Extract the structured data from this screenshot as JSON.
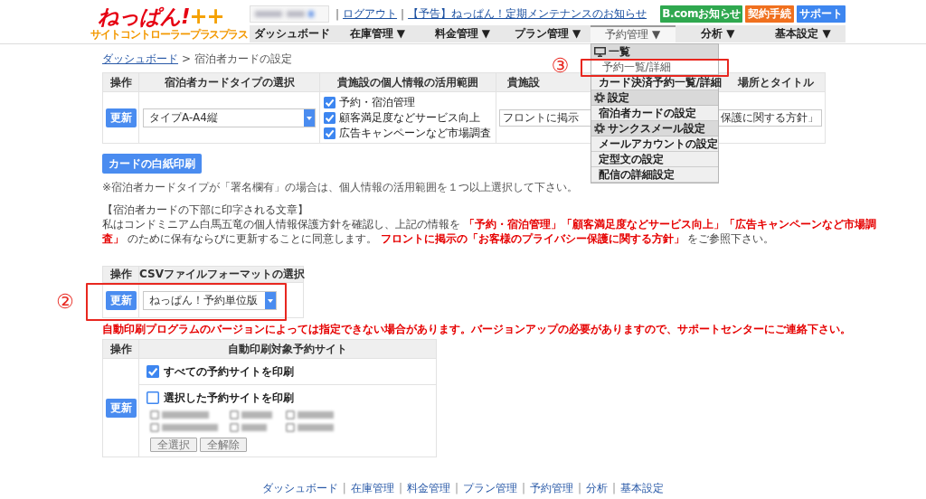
{
  "header": {
    "logo": {
      "name": "ねっぱん!",
      "plus": "++",
      "tagline": "サイトコントローラー",
      "tagline_small": "プラスプラス"
    },
    "separator": "|",
    "links": [
      "ログアウト",
      "【予告】ねっぱん！定期メンテナンスのお知らせ"
    ],
    "buttons": [
      {
        "label": "B.comお知らせ",
        "kind": "notice",
        "color": "#2fa84f"
      },
      {
        "label": "契約手続",
        "kind": "action",
        "color": "#f0701e"
      },
      {
        "label": "サポート",
        "kind": "action",
        "color": "#3d86f0"
      }
    ]
  },
  "nav": [
    {
      "label": "ダッシュボード",
      "selected": false
    },
    {
      "label": "在庫管理 ▼",
      "selected": false
    },
    {
      "label": "料金管理 ▼",
      "selected": false
    },
    {
      "label": "プラン管理 ▼",
      "selected": false
    },
    {
      "label": "予約管理 ▼",
      "selected": true
    },
    {
      "label": "分析 ▼",
      "selected": false
    },
    {
      "label": "基本設定 ▼",
      "selected": false
    }
  ],
  "menu": {
    "sections": [
      {
        "title": "一覧",
        "items": [
          {
            "label": "予約一覧/詳細",
            "selected": true
          },
          {
            "label": "カード決済予約一覧/詳細",
            "selected": false
          }
        ]
      },
      {
        "title": "設定",
        "items": [
          {
            "label": "宿泊者カードの設定",
            "selected": false
          }
        ]
      },
      {
        "title": "サンクスメール設定",
        "items": [
          {
            "label": "メールアカウントの設定",
            "selected": false
          },
          {
            "label": "定型文の設定",
            "selected": false
          },
          {
            "label": "配信の詳細設定",
            "selected": false
          }
        ]
      }
    ],
    "annotation": "③"
  },
  "breadcrumb": {
    "link": "ダッシュボード",
    "separator": ">",
    "current": "宿泊者カードの設定"
  },
  "card_table": {
    "columns": [
      "操作",
      "宿泊者カードタイプの選択",
      "貴施設の個人情報の活用範囲"
    ],
    "column_4": {
      "start": "貴施設",
      "end": "場所とタイトル"
    },
    "button": "更新",
    "card_type": "タイプA-A4縦",
    "scope": [
      {
        "label": "予約・宿泊管理",
        "checked": true
      },
      {
        "label": "顧客満足度などサービス向上",
        "checked": true
      },
      {
        "label": "広告キャンペーンなど市場調査",
        "checked": true
      }
    ],
    "column_4_field": {
      "start": "フロントに掲示",
      "end": "保護に関する方針」"
    }
  },
  "blank_print_button": "カードの白紙印刷",
  "note": "※宿泊者カードタイプが「署名欄有」の場合は、個人情報の活用範囲を１つ以上選択して下さい。",
  "printed_text": {
    "title": "【宿泊者カードの下部に印字される文章】",
    "body": "私はコンドミニアム白馬五竜の個人情報保護方針を確認し、上記の情報を **「予約・宿泊管理」「顧客満足度などサービス向上」「広告キャンペーンなど市場調査」** のために保有ならびに更新することに同意します。 **フロントに掲示の「お客様のプライバシー保護に関する方針」** をご参照下さい。"
  },
  "csv_table": {
    "columns": [
      "操作",
      "CSVファイルフォーマットの選択"
    ],
    "button": "更新",
    "format": "ねっぱん！予約単位版",
    "annotation": "②"
  },
  "warning": "自動印刷プログラムのバージョンによっては指定できない場合があります。バージョンアップの必要がありますので、サポートセンターにご連絡下さい。",
  "print_table": {
    "columns": [
      "操作",
      "自動印刷対象予約サイト"
    ],
    "button": "更新",
    "options": [
      {
        "label": "すべての予約サイトを印刷",
        "checked": true
      },
      {
        "label": "選択した予約サイトを印刷",
        "checked": false
      }
    ],
    "blurred_options": [
      {
        "checked": false
      },
      {
        "checked": false
      },
      {
        "checked": false
      },
      {
        "checked": false
      },
      {
        "checked": false
      },
      {
        "checked": false
      }
    ],
    "small_buttons": [
      "全選択",
      "全解除"
    ]
  },
  "footer": {
    "separator": "|",
    "links": [
      "ダッシュボード",
      "在庫管理",
      "料金管理",
      "プラン管理",
      "予約管理",
      "分析",
      "基本設定"
    ]
  }
}
